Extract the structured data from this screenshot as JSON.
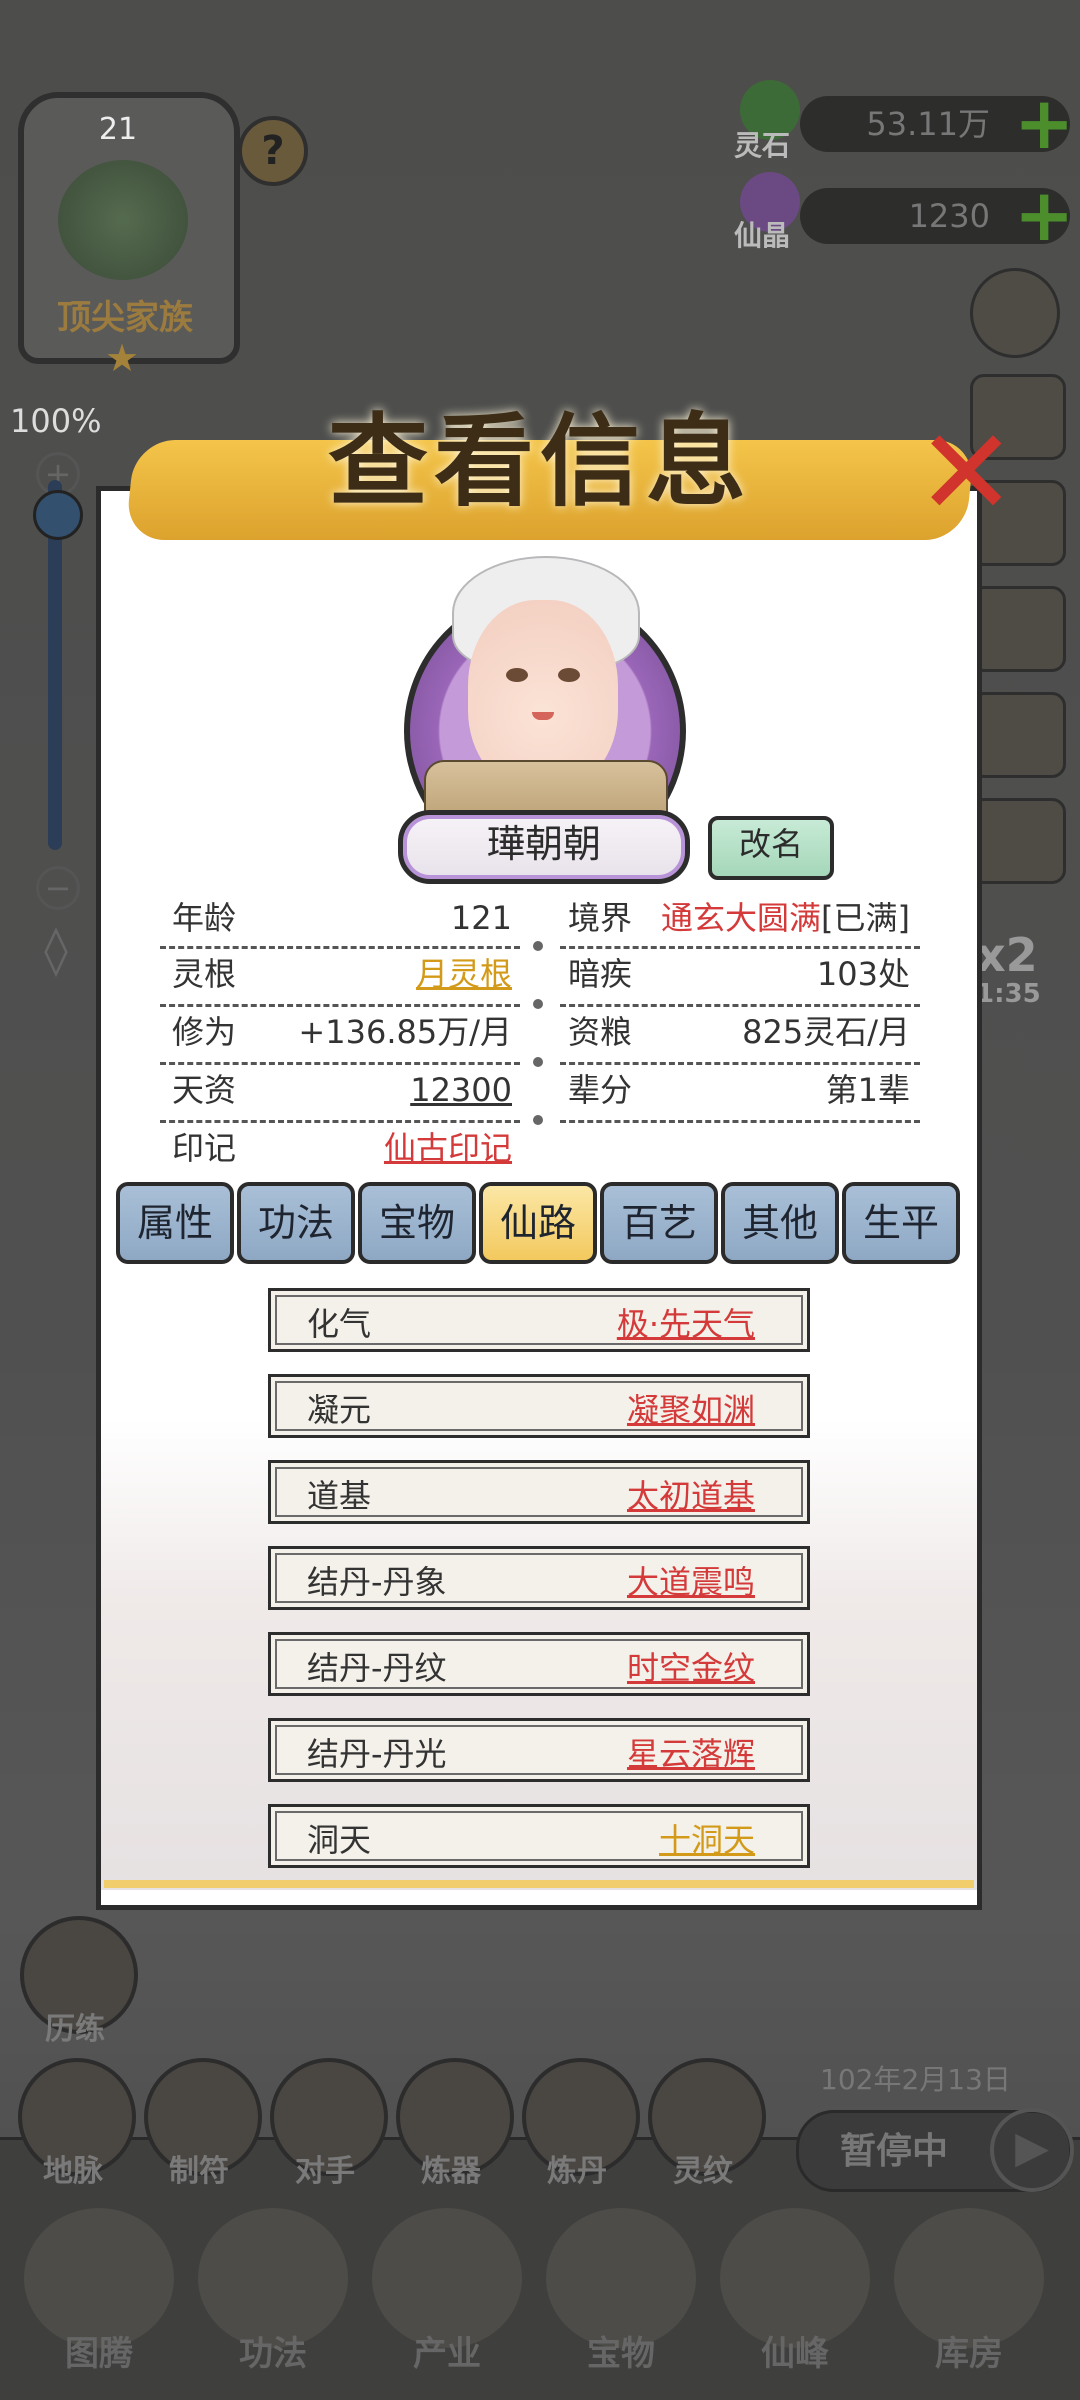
{
  "top": {
    "clan_level": "21",
    "clan_label": "顶尖家族",
    "help_icon": "?",
    "resources": [
      {
        "label": "灵石",
        "value": "53.11万"
      },
      {
        "label": "仙晶",
        "value": "1230"
      }
    ],
    "zoom_percent": "100%"
  },
  "side": {
    "speed_multiplier": "x2",
    "speed_timer": "1:35"
  },
  "dialog": {
    "title": "查看信息",
    "name": "璍朝朝",
    "rename_label": "改名",
    "info": {
      "age_label": "年龄",
      "age_value": "121",
      "realm_label": "境界",
      "realm_value": "通玄大圆满",
      "realm_suffix": "[已满]",
      "root_label": "灵根",
      "root_value": "月灵根",
      "illness_label": "暗疾",
      "illness_value": "103处",
      "cultivation_label": "修为",
      "cultivation_value": "+136.85万/月",
      "salary_label": "资粮",
      "salary_value": "825灵石/月",
      "talent_label": "天资",
      "talent_value": "12300",
      "generation_label": "辈分",
      "generation_value": "第1辈",
      "seal_label": "印记",
      "seal_value": "仙古印记"
    },
    "tabs": [
      "属性",
      "功法",
      "宝物",
      "仙路",
      "百艺",
      "其他",
      "生平"
    ],
    "active_tab": "仙路",
    "path_rows": [
      {
        "label": "化气",
        "value": "极·先天气",
        "color": "#d43a3a"
      },
      {
        "label": "凝元",
        "value": "凝聚如渊",
        "color": "#d43a3a"
      },
      {
        "label": "道基",
        "value": "太初道基",
        "color": "#d43a3a"
      },
      {
        "label": "结丹-丹象",
        "value": "大道震鸣",
        "color": "#d43a3a"
      },
      {
        "label": "结丹-丹纹",
        "value": "时空金纹",
        "color": "#d43a3a"
      },
      {
        "label": "结丹-丹光",
        "value": "星云落辉",
        "color": "#d43a3a"
      },
      {
        "label": "洞天",
        "value": "十洞天",
        "color": "#d39a19"
      }
    ]
  },
  "bottom": {
    "trial_label": "历练",
    "actions": [
      "地脉",
      "制符",
      "对手",
      "炼器",
      "炼丹",
      "灵纹"
    ],
    "date": "102年2月13日",
    "pause_label": "暂停中",
    "nav": [
      "图腾",
      "功法",
      "产业",
      "宝物",
      "仙峰",
      "库房"
    ]
  }
}
